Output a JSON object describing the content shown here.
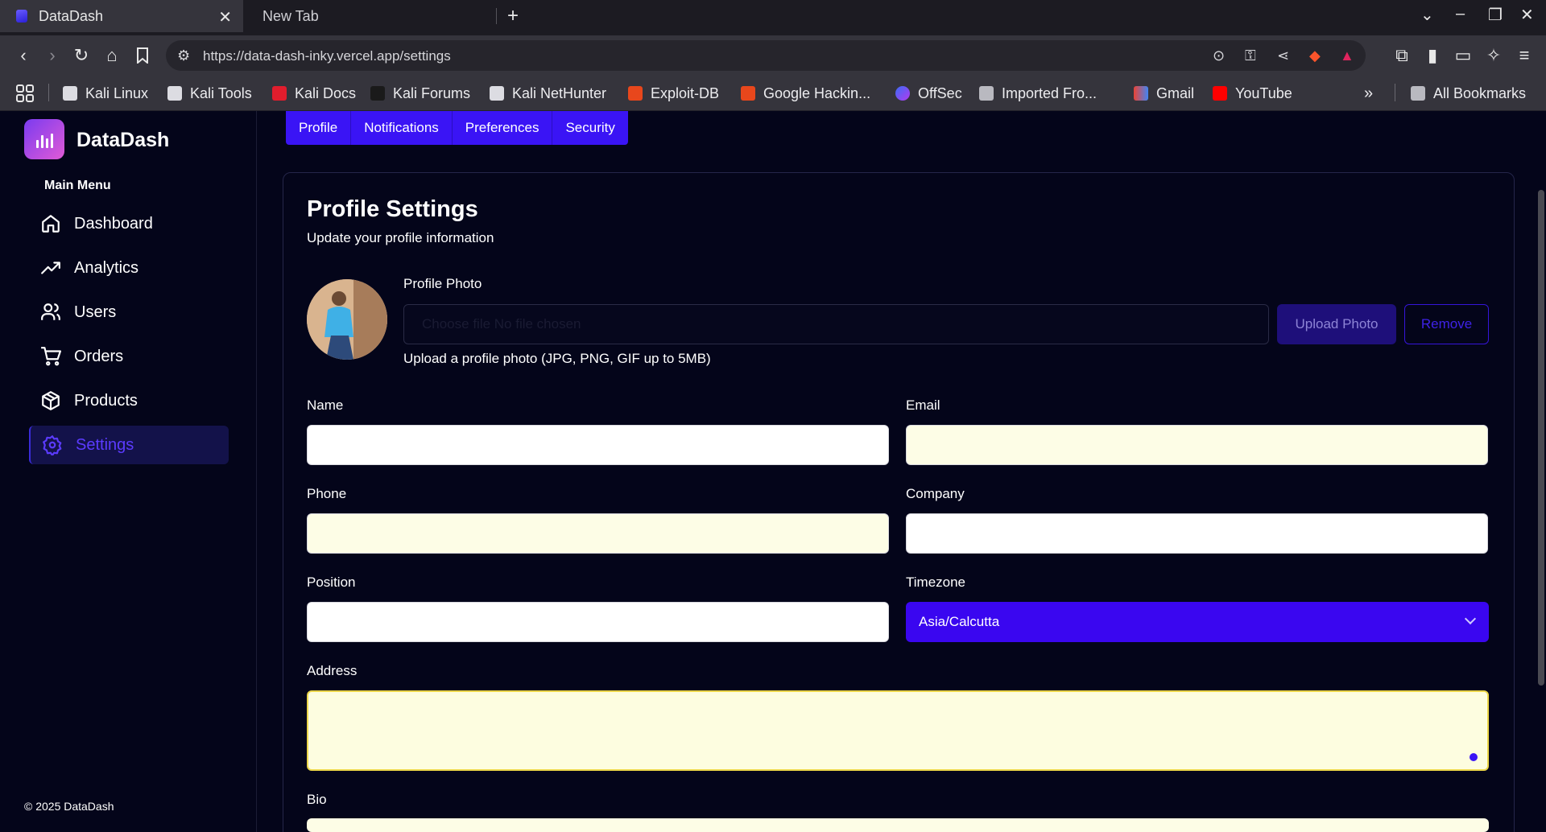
{
  "browser": {
    "active_tab": "DataDash",
    "inactive_tab": "New Tab",
    "url": "https://data-dash-inky.vercel.app/settings",
    "bookmarks": [
      "Kali Linux",
      "Kali Tools",
      "Kali Docs",
      "Kali Forums",
      "Kali NetHunter",
      "Exploit-DB",
      "Google Hackin...",
      "OffSec",
      "Imported Fro...",
      "Gmail",
      "YouTube"
    ],
    "all_bookmarks": "All Bookmarks"
  },
  "sidebar": {
    "brand": "DataDash",
    "menu_title": "Main Menu",
    "items": [
      {
        "label": "Dashboard",
        "icon": "home-icon"
      },
      {
        "label": "Analytics",
        "icon": "trend-icon"
      },
      {
        "label": "Users",
        "icon": "users-icon"
      },
      {
        "label": "Orders",
        "icon": "cart-icon"
      },
      {
        "label": "Products",
        "icon": "box-icon"
      },
      {
        "label": "Settings",
        "icon": "gear-icon"
      }
    ],
    "footer": "© 2025 DataDash"
  },
  "tabs": [
    "Profile",
    "Notifications",
    "Preferences",
    "Security"
  ],
  "profile": {
    "title": "Profile Settings",
    "subtitle": "Update your profile information",
    "photo_label": "Profile Photo",
    "file_text": "Choose file  No file chosen",
    "upload_button": "Upload Photo",
    "remove_button": "Remove",
    "photo_help": "Upload a profile photo (JPG, PNG, GIF up to 5MB)",
    "fields": {
      "name": {
        "label": "Name",
        "value": ""
      },
      "email": {
        "label": "Email",
        "value": ""
      },
      "phone": {
        "label": "Phone",
        "value": ""
      },
      "company": {
        "label": "Company",
        "value": ""
      },
      "position": {
        "label": "Position",
        "value": ""
      },
      "timezone": {
        "label": "Timezone",
        "value": "Asia/Calcutta"
      },
      "address": {
        "label": "Address",
        "value": ""
      },
      "bio": {
        "label": "Bio",
        "value": ""
      }
    }
  },
  "colors": {
    "accent": "#3a14f5",
    "background": "#04051a"
  }
}
